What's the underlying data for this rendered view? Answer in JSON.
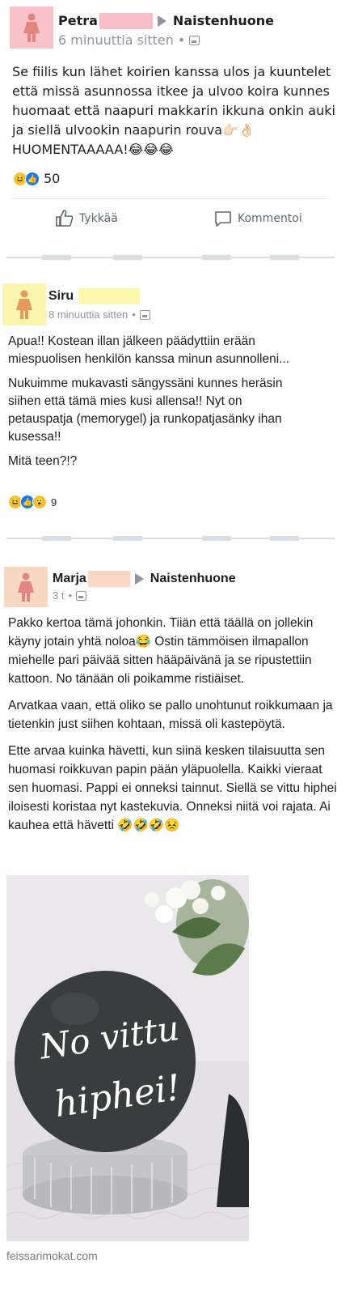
{
  "colors": {
    "avatar_bg_1": "#f8c2c9",
    "avatar_bg_2": "#fbf6ae",
    "avatar_bg_3": "#f9d8c3",
    "redact_1": "#f8bfc7",
    "redact_2": "#fbf8ae",
    "redact_3": "#fbd8c6",
    "figure": "#e0857f",
    "figure_2": "#e39a5a",
    "balloon": "#3a3d3e",
    "text_secondary": "#90949c"
  },
  "posts": [
    {
      "author": "Petra",
      "group": "Naistenhuone",
      "time": "6 minuuttia sitten",
      "body": [
        "Se fiilis kun lähet koirien kanssa ulos ja kuuntelet että missä asunnossa itkee ja ulvoo koira kunnes huomaat että naapuri  makkarin ikkuna onkin auki ja siellä ulvookin naapurin rouva👉🏻👌🏻 HUOMENTAAAAA!😂😂😂"
      ],
      "reactions": [
        "haha",
        "like"
      ],
      "reaction_count": "50",
      "like_label": "Tykkää",
      "comment_label": "Kommentoi"
    },
    {
      "author": "Siru",
      "time": "8 minuuttia sitten",
      "body": [
        "Apua!! Kostean illan jälkeen päädyttiin erään miespuolisen henkilön kanssa minun asunnolleni...",
        "Nukuimme mukavasti sängyssäni kunnes heräsin siihen että tämä mies kusi allensa!! Nyt on petauspatja (memorygel) ja runkopatjasänky ihan kusessa!!",
        "Mitä teen?!?"
      ],
      "reactions": [
        "haha",
        "like",
        "wow"
      ],
      "reaction_count": "9"
    },
    {
      "author": "Marja",
      "group": "Naistenhuone",
      "time": "3 t",
      "body": [
        "Pakko kertoa tämä johonkin. Tiiän että täällä on jollekin käyny jotain yhtä noloa😂 Ostin tämmöisen ilmapallon miehelle pari päivää sitten hääpäivänä ja se ripustettiin kattoon. No tänään oli poikamme ristiäiset.",
        "Arvatkaa vaan, että oliko se pallo unohtunut roikkumaan ja tietenkin just siihen kohtaan, missä oli kastepöytä.",
        "Ette arvaa kuinka hävetti, kun siinä kesken tilaisuutta sen huomasi roikkuvan papin pään yläpuolella. Kaikki vieraat sen huomasi. Pappi ei onneksi tainnut. Siellä se vittu hiphei iloisesti koristaa nyt kastekuvia. Onneksi niitä voi rajata. Ai kauhea että hävetti 🤣🤣🤣😣"
      ],
      "photo_text_line1": "No vittu",
      "photo_text_line2": "hiphei!"
    }
  ],
  "watermark": "feissarimokat.com"
}
